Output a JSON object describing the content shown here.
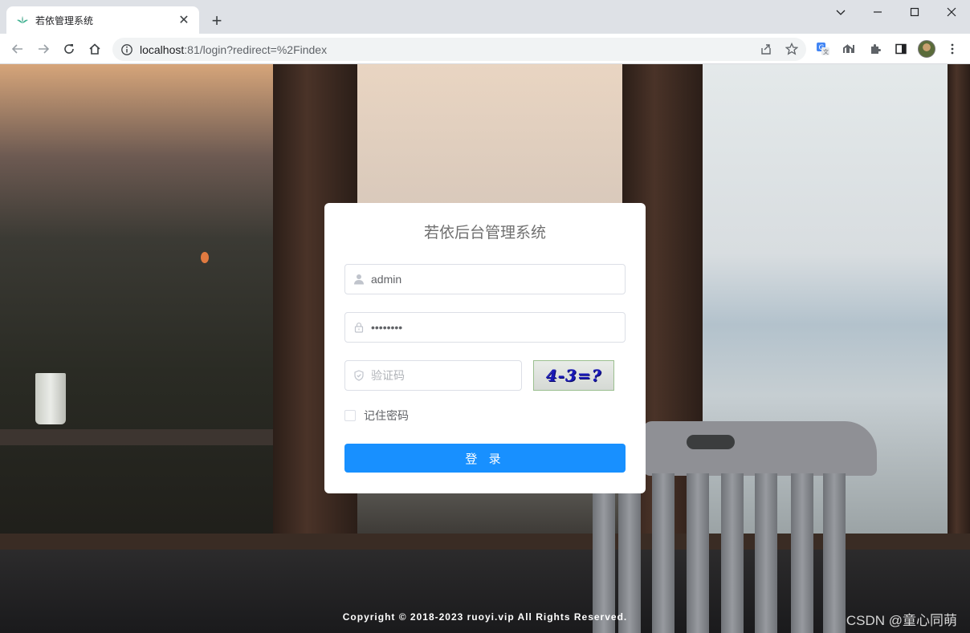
{
  "browser": {
    "tab_title": "若依管理系统",
    "tab_close": "✕",
    "new_tab": "+",
    "url_host": "localhost",
    "url_rest": ":81/login?redirect=%2Findex"
  },
  "login": {
    "title": "若依后台管理系统",
    "username_value": "admin",
    "password_masked": "••••••••",
    "code_placeholder": "验证码",
    "captcha_text": "4-3=?",
    "remember_label": "记住密码",
    "login_button": "登 录"
  },
  "footer": {
    "copyright": "Copyright © 2018-2023 ruoyi.vip All Rights Reserved."
  },
  "watermark": "CSDN @童心同萌",
  "colors": {
    "primary_button": "#1890ff",
    "card_background": "#ffffff",
    "titlebar": "#dee1e6"
  }
}
